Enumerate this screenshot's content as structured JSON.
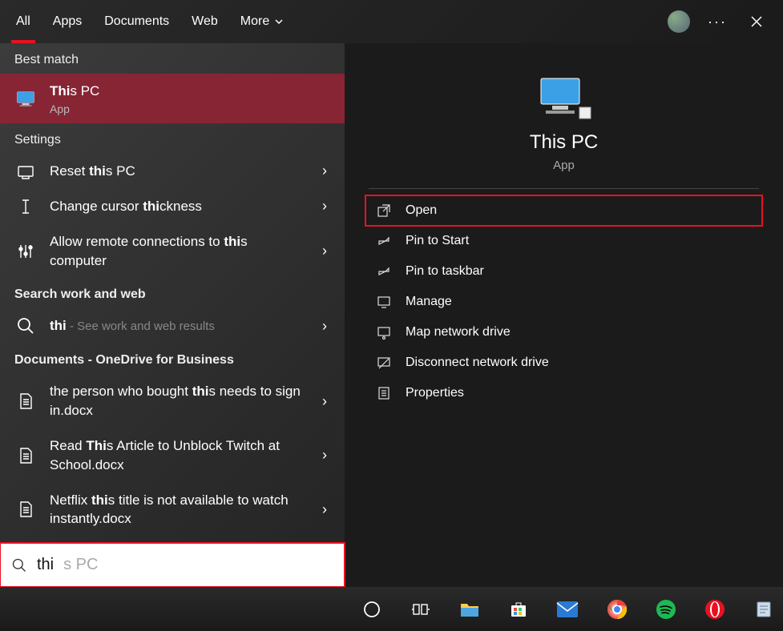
{
  "tabs": {
    "all": "All",
    "apps": "Apps",
    "documents": "Documents",
    "web": "Web",
    "more": "More"
  },
  "sections": {
    "best_match": "Best match",
    "settings": "Settings",
    "search_work_web": "Search work and web",
    "docs_onedrive": "Documents - OneDrive for Business"
  },
  "best": {
    "title_pre": "Thi",
    "title_post": "s PC",
    "sub": "App"
  },
  "settings_items": [
    {
      "pre": "Reset ",
      "bold": "thi",
      "post": "s PC"
    },
    {
      "pre": "Change cursor ",
      "bold": "thi",
      "post": "ckness"
    },
    {
      "pre": "Allow remote connections to ",
      "bold": "thi",
      "post": "s computer"
    }
  ],
  "web_item": {
    "bold": "thi",
    "hint": " - See work and web results"
  },
  "doc_items": [
    {
      "pre": "the person who bought ",
      "bold": "thi",
      "post": "s needs to sign in.docx"
    },
    {
      "pre": "Read ",
      "bold": "Thi",
      "post": "s Article to Unblock Twitch at School.docx"
    },
    {
      "pre": "Netflix ",
      "bold": "thi",
      "post": "s title is not available to watch instantly.docx"
    }
  ],
  "preview": {
    "title": "This PC",
    "sub": "App",
    "actions": [
      "Open",
      "Pin to Start",
      "Pin to taskbar",
      "Manage",
      "Map network drive",
      "Disconnect network drive",
      "Properties"
    ]
  },
  "search": {
    "typed": "thi",
    "ghost": "s PC"
  }
}
